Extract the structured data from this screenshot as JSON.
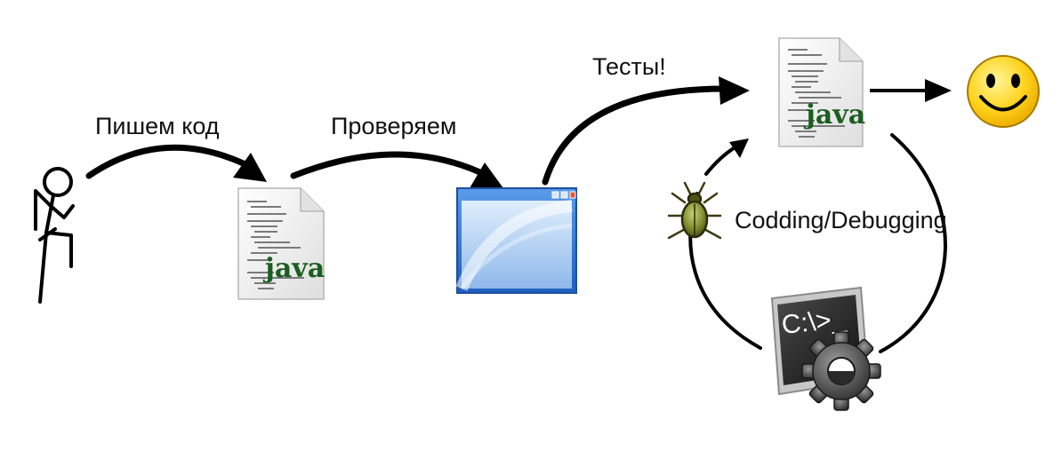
{
  "labels": {
    "write_code": "Пишем код",
    "check": "Проверяем",
    "tests": "Тесты!",
    "cycle": "Codding/Debugging"
  },
  "file_icon": {
    "extension_text": "java"
  },
  "terminal_icon": {
    "prompt_text": "C:\\>_"
  },
  "icons": {
    "person": "stick-figure-icon",
    "source_file": "java-file-icon",
    "app_window": "browser-window-icon",
    "bug": "bug-icon",
    "terminal": "terminal-gear-icon",
    "result": "smiley-face-icon"
  },
  "colors": {
    "arrow": "#000000",
    "java_text": "#1b5e20",
    "window_frame": "#2e6fc9",
    "smiley": "#ffd21a"
  }
}
